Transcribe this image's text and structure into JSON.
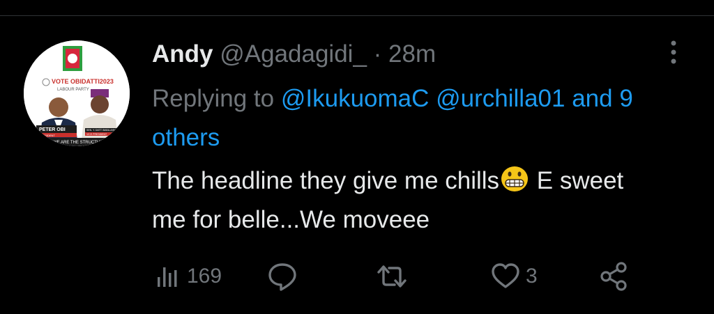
{
  "tweet": {
    "author": {
      "display_name": "Andy",
      "handle": "@Agadagidi_",
      "separator": "·",
      "time": "28m"
    },
    "avatar": {
      "banner_text": "VOTE OBIDATTI2023",
      "party_text": "LABOUR PARTY",
      "left_name": "PETER OBI",
      "left_role": "PRESIDENT",
      "right_name": "SEN. Y. DATTI BABA-AHMED",
      "right_role": "VICE PRESIDENT",
      "bottom_text": "WE ARE THE STRUCTURE"
    },
    "reply": {
      "prefix": "Replying to",
      "mention1": "@IkukuomaC",
      "mention2": "@urchilla01",
      "others": "and 9 others"
    },
    "text_part1": "The headline they give me chills",
    "text_part2": " E sweet me for belle...We moveee",
    "actions": {
      "views": "169",
      "replies": "",
      "retweets": "",
      "likes": "3"
    },
    "colors": {
      "background": "#000000",
      "text": "#e7e9ea",
      "muted": "#71767b",
      "link": "#1d9bf0"
    },
    "icons": [
      "more-icon",
      "views-icon",
      "reply-icon",
      "retweet-icon",
      "like-icon",
      "share-icon",
      "grinning-emoji"
    ]
  }
}
